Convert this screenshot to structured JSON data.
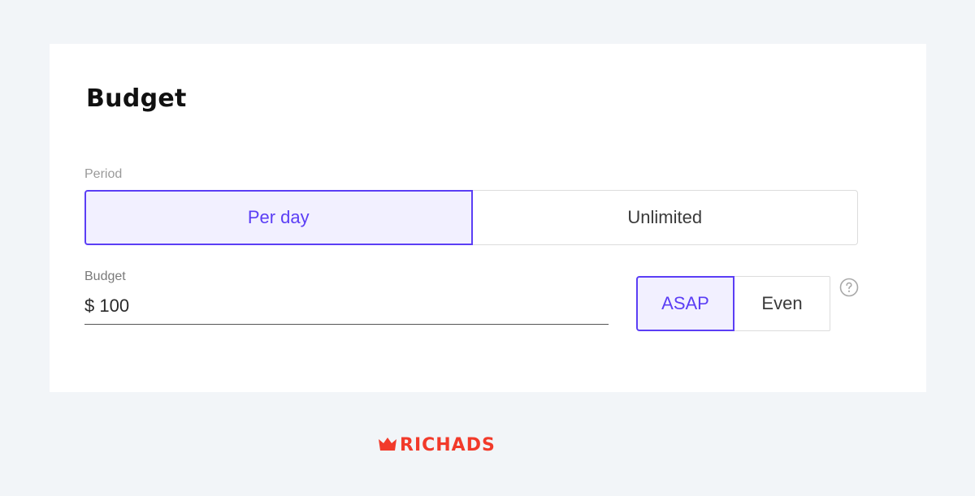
{
  "budget_card": {
    "title": "Budget",
    "period": {
      "label": "Period",
      "options": [
        {
          "label": "Per day",
          "selected": true
        },
        {
          "label": "Unlimited",
          "selected": false
        }
      ]
    },
    "budget": {
      "label": "Budget",
      "value": "$ 100"
    },
    "pacing": {
      "options": [
        {
          "label": "ASAP",
          "selected": true
        },
        {
          "label": "Even",
          "selected": false
        }
      ],
      "help_icon": "question-circle-icon"
    }
  },
  "brand": {
    "logo": "RICHADS",
    "color": "#f23a2a"
  },
  "colors": {
    "accent": "#5b3ef5",
    "accent_bg": "#f2f0ff",
    "page_bg": "#f2f5f8"
  }
}
